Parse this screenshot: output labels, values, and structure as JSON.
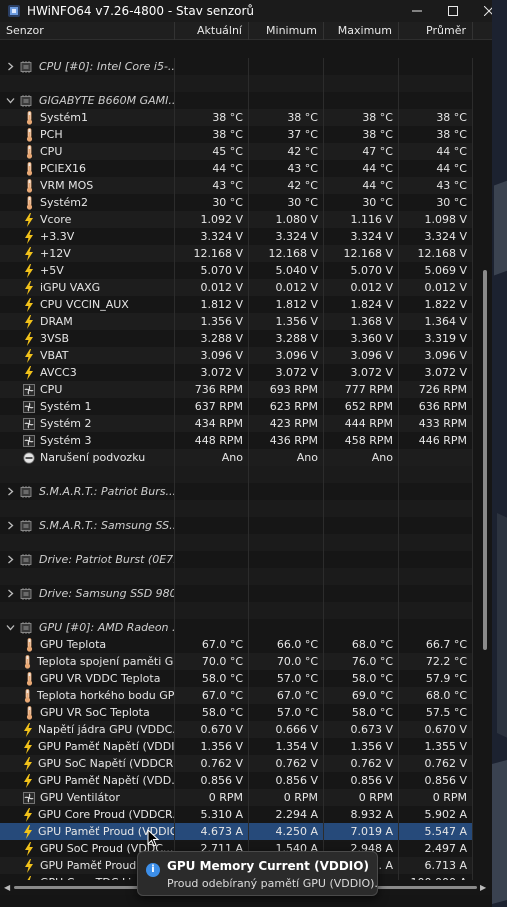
{
  "window": {
    "title": "HWiNFO64 v7.26-4800 - Stav senzorů"
  },
  "columns": {
    "sensor": "Senzor",
    "current": "Aktuální",
    "minimum": "Minimum",
    "maximum": "Maximum",
    "average": "Průměr"
  },
  "rows": [
    {
      "kind": "group",
      "label": "CPU [#0]: Intel Core i5-...",
      "expanded": false,
      "icon": "chip-icon"
    },
    {
      "kind": "gap"
    },
    {
      "kind": "group",
      "label": "GIGABYTE B660M GAMI...",
      "expanded": true,
      "icon": "chip-icon"
    },
    {
      "kind": "sensor",
      "icon": "thermometer-icon",
      "name": "Systém1",
      "cur": "38 °C",
      "min": "38 °C",
      "max": "38 °C",
      "avg": "38 °C"
    },
    {
      "kind": "sensor",
      "icon": "thermometer-icon",
      "name": "PCH",
      "cur": "38 °C",
      "min": "37 °C",
      "max": "38 °C",
      "avg": "38 °C"
    },
    {
      "kind": "sensor",
      "icon": "thermometer-icon",
      "name": "CPU",
      "cur": "45 °C",
      "min": "42 °C",
      "max": "47 °C",
      "avg": "44 °C"
    },
    {
      "kind": "sensor",
      "icon": "thermometer-icon",
      "name": "PCIEX16",
      "cur": "44 °C",
      "min": "43 °C",
      "max": "44 °C",
      "avg": "44 °C"
    },
    {
      "kind": "sensor",
      "icon": "thermometer-icon",
      "name": "VRM MOS",
      "cur": "43 °C",
      "min": "42 °C",
      "max": "44 °C",
      "avg": "43 °C"
    },
    {
      "kind": "sensor",
      "icon": "thermometer-icon",
      "name": "Systém2",
      "cur": "30 °C",
      "min": "30 °C",
      "max": "30 °C",
      "avg": "30 °C"
    },
    {
      "kind": "sensor",
      "icon": "bolt-icon",
      "name": "Vcore",
      "cur": "1.092 V",
      "min": "1.080 V",
      "max": "1.116 V",
      "avg": "1.098 V"
    },
    {
      "kind": "sensor",
      "icon": "bolt-icon",
      "name": "+3.3V",
      "cur": "3.324 V",
      "min": "3.324 V",
      "max": "3.324 V",
      "avg": "3.324 V"
    },
    {
      "kind": "sensor",
      "icon": "bolt-icon",
      "name": "+12V",
      "cur": "12.168 V",
      "min": "12.168 V",
      "max": "12.168 V",
      "avg": "12.168 V"
    },
    {
      "kind": "sensor",
      "icon": "bolt-icon",
      "name": "+5V",
      "cur": "5.070 V",
      "min": "5.040 V",
      "max": "5.070 V",
      "avg": "5.069 V"
    },
    {
      "kind": "sensor",
      "icon": "bolt-icon",
      "name": "iGPU VAXG",
      "cur": "0.012 V",
      "min": "0.012 V",
      "max": "0.012 V",
      "avg": "0.012 V"
    },
    {
      "kind": "sensor",
      "icon": "bolt-icon",
      "name": "CPU VCCIN_AUX",
      "cur": "1.812 V",
      "min": "1.812 V",
      "max": "1.824 V",
      "avg": "1.822 V"
    },
    {
      "kind": "sensor",
      "icon": "bolt-icon",
      "name": "DRAM",
      "cur": "1.356 V",
      "min": "1.356 V",
      "max": "1.368 V",
      "avg": "1.364 V"
    },
    {
      "kind": "sensor",
      "icon": "bolt-icon",
      "name": "3VSB",
      "cur": "3.288 V",
      "min": "3.288 V",
      "max": "3.360 V",
      "avg": "3.319 V"
    },
    {
      "kind": "sensor",
      "icon": "bolt-icon",
      "name": "VBAT",
      "cur": "3.096 V",
      "min": "3.096 V",
      "max": "3.096 V",
      "avg": "3.096 V"
    },
    {
      "kind": "sensor",
      "icon": "bolt-icon",
      "name": "AVCC3",
      "cur": "3.072 V",
      "min": "3.072 V",
      "max": "3.072 V",
      "avg": "3.072 V"
    },
    {
      "kind": "sensor",
      "icon": "fan-icon",
      "name": "CPU",
      "cur": "736 RPM",
      "min": "693 RPM",
      "max": "777 RPM",
      "avg": "726 RPM"
    },
    {
      "kind": "sensor",
      "icon": "fan-icon",
      "name": "Systém 1",
      "cur": "637 RPM",
      "min": "623 RPM",
      "max": "652 RPM",
      "avg": "636 RPM"
    },
    {
      "kind": "sensor",
      "icon": "fan-icon",
      "name": "Systém 2",
      "cur": "434 RPM",
      "min": "423 RPM",
      "max": "444 RPM",
      "avg": "433 RPM"
    },
    {
      "kind": "sensor",
      "icon": "fan-icon",
      "name": "Systém 3",
      "cur": "448 RPM",
      "min": "436 RPM",
      "max": "458 RPM",
      "avg": "446 RPM"
    },
    {
      "kind": "sensor",
      "icon": "intrusion-icon",
      "name": "Narušení podvozku",
      "cur": "Ano",
      "min": "Ano",
      "max": "Ano",
      "avg": ""
    },
    {
      "kind": "gap"
    },
    {
      "kind": "group",
      "label": "S.M.A.R.T.: Patriot Burs...",
      "expanded": false,
      "icon": "chip-icon"
    },
    {
      "kind": "gap"
    },
    {
      "kind": "group",
      "label": "S.M.A.R.T.: Samsung SS...",
      "expanded": false,
      "icon": "chip-icon"
    },
    {
      "kind": "gap"
    },
    {
      "kind": "group",
      "label": "Drive: Patriot Burst (0E7...",
      "expanded": false,
      "icon": "chip-icon"
    },
    {
      "kind": "gap"
    },
    {
      "kind": "group",
      "label": "Drive: Samsung SSD 980...",
      "expanded": false,
      "icon": "chip-icon"
    },
    {
      "kind": "gap"
    },
    {
      "kind": "group",
      "label": "GPU [#0]: AMD Radeon ...",
      "expanded": true,
      "icon": "chip-icon"
    },
    {
      "kind": "sensor",
      "icon": "thermometer-icon",
      "name": "GPU Teplota",
      "cur": "67.0 °C",
      "min": "66.0 °C",
      "max": "68.0 °C",
      "avg": "66.7 °C"
    },
    {
      "kind": "sensor",
      "icon": "thermometer-icon",
      "name": "Teplota spojení paměti GPU",
      "cur": "70.0 °C",
      "min": "70.0 °C",
      "max": "76.0 °C",
      "avg": "72.2 °C"
    },
    {
      "kind": "sensor",
      "icon": "thermometer-icon",
      "name": "GPU VR VDDC Teplota",
      "cur": "58.0 °C",
      "min": "57.0 °C",
      "max": "58.0 °C",
      "avg": "57.9 °C"
    },
    {
      "kind": "sensor",
      "icon": "thermometer-icon",
      "name": "Teplota horkého bodu GPU",
      "cur": "67.0 °C",
      "min": "67.0 °C",
      "max": "69.0 °C",
      "avg": "68.0 °C"
    },
    {
      "kind": "sensor",
      "icon": "thermometer-icon",
      "name": "GPU VR SoC Teplota",
      "cur": "58.0 °C",
      "min": "57.0 °C",
      "max": "58.0 °C",
      "avg": "57.5 °C"
    },
    {
      "kind": "sensor",
      "icon": "bolt-icon",
      "name": "Napětí jádra GPU (VDDC...",
      "cur": "0.670 V",
      "min": "0.666 V",
      "max": "0.673 V",
      "avg": "0.670 V"
    },
    {
      "kind": "sensor",
      "icon": "bolt-icon",
      "name": "GPU Paměť Napětí (VDDIO)",
      "cur": "1.356 V",
      "min": "1.354 V",
      "max": "1.356 V",
      "avg": "1.355 V"
    },
    {
      "kind": "sensor",
      "icon": "bolt-icon",
      "name": "GPU SoC Napětí (VDDCR...",
      "cur": "0.762 V",
      "min": "0.762 V",
      "max": "0.762 V",
      "avg": "0.762 V"
    },
    {
      "kind": "sensor",
      "icon": "bolt-icon",
      "name": "GPU Paměť Napětí (VDD...",
      "cur": "0.856 V",
      "min": "0.856 V",
      "max": "0.856 V",
      "avg": "0.856 V"
    },
    {
      "kind": "sensor",
      "icon": "fan-icon",
      "name": "GPU Ventilátor",
      "cur": "0 RPM",
      "min": "0 RPM",
      "max": "0 RPM",
      "avg": "0 RPM"
    },
    {
      "kind": "sensor",
      "icon": "bolt-icon",
      "name": "GPU Core Proud (VDDCR...",
      "cur": "5.310 A",
      "min": "2.294 A",
      "max": "8.932 A",
      "avg": "5.902 A"
    },
    {
      "kind": "sensor",
      "icon": "bolt-icon",
      "name": "GPU Paměť Proud (VDDIO)",
      "cur": "4.673 A",
      "min": "4.250 A",
      "max": "7.019 A",
      "avg": "5.547 A",
      "selected": true
    },
    {
      "kind": "sensor",
      "icon": "bolt-icon",
      "name": "GPU SoC Proud (VDDC...",
      "cur": "2.711 A",
      "min": "1.540 A",
      "max": "2.948 A",
      "avg": "2.497 A"
    },
    {
      "kind": "sensor",
      "icon": "bolt-icon",
      "name": "GPU Paměť Proud (...",
      "cur": "",
      "min": "",
      "max": "... A",
      "avg": "6.713 A"
    },
    {
      "kind": "sensor",
      "icon": "bolt-icon",
      "name": "GPU Core TDC Limit",
      "cur": "",
      "min": "",
      "max": "",
      "avg": "100.000 A"
    }
  ],
  "tooltip": {
    "title": "GPU Memory Current (VDDIO)",
    "text": "Proud odebíraný pamětí GPU (VDDIO).",
    "icon": "info-icon"
  },
  "colors": {
    "thermometer": "#e8a874",
    "bolt": "#f2c21a",
    "fan": "#d0d0d0",
    "info": "#3c8ee8"
  }
}
